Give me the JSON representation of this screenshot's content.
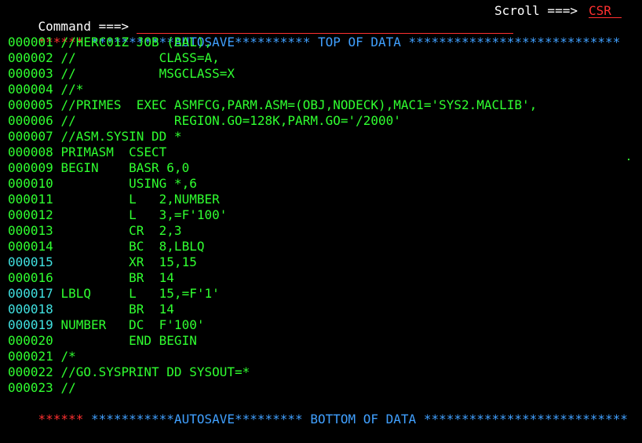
{
  "command": {
    "label": "Command ===>",
    "value": ""
  },
  "scroll": {
    "label": "Scroll ===>",
    "value": "CSR"
  },
  "top_banner": {
    "marker": "******",
    "text": "***********AUTOSAVE********** TOP OF DATA ****************************"
  },
  "bottom_banner": {
    "marker": "******",
    "text": "***********AUTOSAVE********* BOTTOM OF DATA ***************************"
  },
  "lines": [
    {
      "num": "000001",
      "text": "//HERC01Z JOB (BAL),",
      "num_color": "green"
    },
    {
      "num": "000002",
      "text": "//           CLASS=A,",
      "num_color": "green"
    },
    {
      "num": "000003",
      "text": "//           MSGCLASS=X",
      "num_color": "green"
    },
    {
      "num": "000004",
      "text": "//*",
      "num_color": "green"
    },
    {
      "num": "000005",
      "text": "//PRIMES  EXEC ASMFCG,PARM.ASM=(OBJ,NODECK),MAC1='SYS2.MACLIB',",
      "num_color": "green"
    },
    {
      "num": "000006",
      "text": "//             REGION.GO=128K,PARM.GO='/2000'",
      "num_color": "green"
    },
    {
      "num": "000007",
      "text": "//ASM.SYSIN DD *",
      "num_color": "green"
    },
    {
      "num": "000008",
      "text": "PRIMASM  CSECT",
      "num_color": "green"
    },
    {
      "num": "000009",
      "text": "BEGIN    BASR 6,0",
      "num_color": "green"
    },
    {
      "num": "000010",
      "text": "         USING *,6",
      "num_color": "green"
    },
    {
      "num": "000011",
      "text": "         L   2,NUMBER",
      "num_color": "green"
    },
    {
      "num": "000012",
      "text": "         L   3,=F'100'",
      "num_color": "green"
    },
    {
      "num": "000013",
      "text": "         CR  2,3",
      "num_color": "green"
    },
    {
      "num": "000014",
      "text": "         BC  8,LBLQ",
      "num_color": "green"
    },
    {
      "num": "000015",
      "text": "         XR  15,15",
      "num_color": "cyan"
    },
    {
      "num": "000016",
      "text": "         BR  14",
      "num_color": "green"
    },
    {
      "num": "000017",
      "text": "LBLQ     L   15,=F'1'",
      "num_color": "cyan"
    },
    {
      "num": "000018",
      "text": "         BR  14",
      "num_color": "cyan"
    },
    {
      "num": "000019",
      "text": "NUMBER   DC  F'100'",
      "num_color": "cyan"
    },
    {
      "num": "000020",
      "text": "         END BEGIN",
      "num_color": "green"
    },
    {
      "num": "000021",
      "text": "/*",
      "num_color": "green"
    },
    {
      "num": "000022",
      "text": "//GO.SYSPRINT DD SYSOUT=*",
      "num_color": "green"
    },
    {
      "num": "000023",
      "text": "//",
      "num_color": "green"
    }
  ],
  "colors": {
    "background": "#000000",
    "code_text": "#30ff30",
    "line_number": "#40e0e0",
    "banner": "#40a0ff",
    "marker": "#ff3030",
    "label": "#ffffff"
  }
}
